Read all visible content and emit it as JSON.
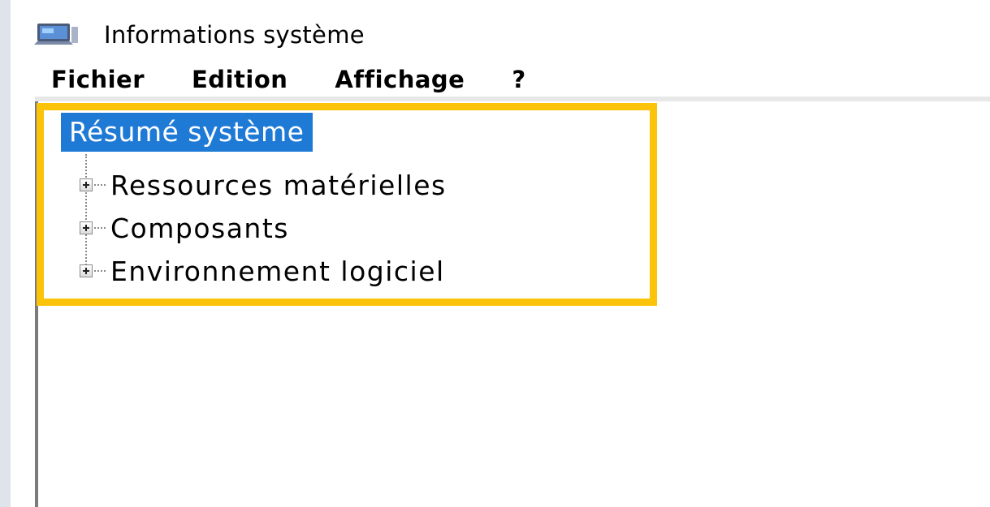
{
  "window": {
    "title": "Informations système",
    "icon": "system-info-app-icon"
  },
  "menu": {
    "items": [
      {
        "label": "Fichier"
      },
      {
        "label": "Edition"
      },
      {
        "label": "Affichage"
      },
      {
        "label": "?"
      }
    ]
  },
  "tree": {
    "root": {
      "label": "Résumé système",
      "selected": true
    },
    "children": [
      {
        "label": "Ressources matérielles",
        "expander": "plus-expander-icon"
      },
      {
        "label": "Composants",
        "expander": "plus-expander-icon"
      },
      {
        "label": "Environnement logiciel",
        "expander": "plus-expander-icon"
      }
    ]
  },
  "colors": {
    "highlight_border": "#fbc30a",
    "selection": "#1f7ad6"
  }
}
